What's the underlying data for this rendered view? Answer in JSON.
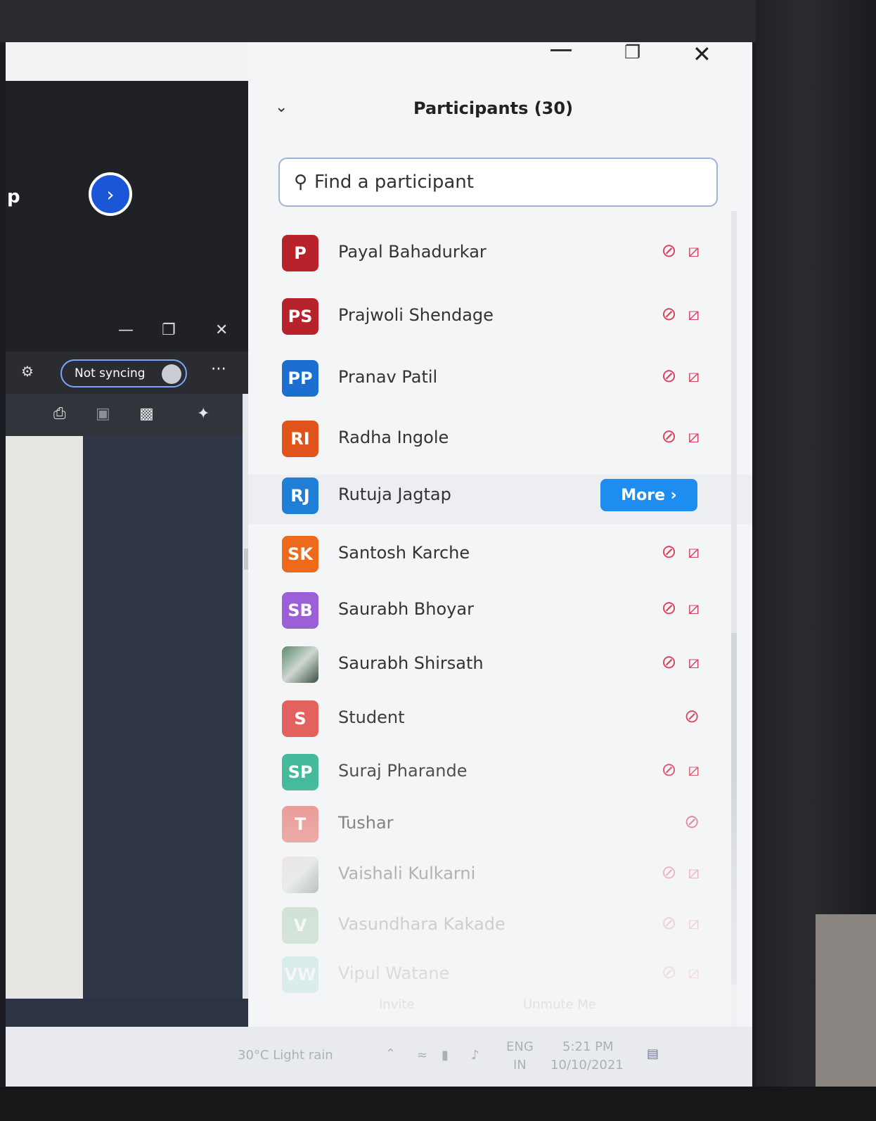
{
  "left_app": {
    "fragment_text": "p",
    "sync_label": "Not syncing"
  },
  "panel": {
    "title": "Participants (30)",
    "search_placeholder": "Find a participant"
  },
  "participants": [
    {
      "initials": "P",
      "name": "Payal Bahadurkar",
      "color": "#b8232b",
      "mic_muted": true,
      "video_off": true
    },
    {
      "initials": "PS",
      "name": "Prajwoli Shendage",
      "color": "#b8232b",
      "mic_muted": true,
      "video_off": true
    },
    {
      "initials": "PP",
      "name": "Pranav Patil",
      "color": "#1c6fd1",
      "mic_muted": true,
      "video_off": true
    },
    {
      "initials": "RI",
      "name": "Radha Ingole",
      "color": "#e0541b",
      "mic_muted": true,
      "video_off": true
    },
    {
      "initials": "RJ",
      "name": "Rutuja Jagtap",
      "color": "#1f7fd6",
      "hover_action": "More ›"
    },
    {
      "initials": "SK",
      "name": "Santosh Karche",
      "color": "#ec6a19",
      "mic_muted": true,
      "video_off": true
    },
    {
      "initials": "SB",
      "name": "Saurabh Bhoyar",
      "color": "#9b5fd8",
      "mic_muted": true,
      "video_off": true
    },
    {
      "initials": "",
      "name": "Saurabh Shirsath",
      "color": "#5b8a6a",
      "photo_avatar": true,
      "mic_muted": true,
      "video_off": true
    },
    {
      "initials": "S",
      "name": "Student",
      "color": "#e35a57",
      "mic_muted": true
    },
    {
      "initials": "SP",
      "name": "Suraj Pharande",
      "color": "#26b08a",
      "mic_muted": true,
      "video_off": true
    },
    {
      "initials": "T",
      "name": "Tushar",
      "color": "#e56a63",
      "mic_muted": true
    },
    {
      "initials": "",
      "name": "Vaishali Kulkarni",
      "color": "#e9c9c9",
      "photo_avatar": true,
      "mic_muted": true,
      "video_off": true
    },
    {
      "initials": "V",
      "name": "Vasundhara Kakade",
      "color": "#4f9e5a",
      "mic_muted": true,
      "video_off": true
    },
    {
      "initials": "VW",
      "name": "Vipul Watane",
      "color": "#2fb1a2",
      "mic_muted": true,
      "video_off": true
    }
  ],
  "footer": {
    "invite_label": "Invite",
    "unmute_label": "Unmute Me"
  },
  "taskbar": {
    "weather": "30°C  Light rain",
    "lang_1": "ENG",
    "lang_2": "IN",
    "time": "5:21 PM",
    "date": "10/10/2021"
  },
  "icons": {
    "mic_muted": "mic-muted-icon",
    "video_off": "video-off-icon",
    "search": "search-icon"
  }
}
